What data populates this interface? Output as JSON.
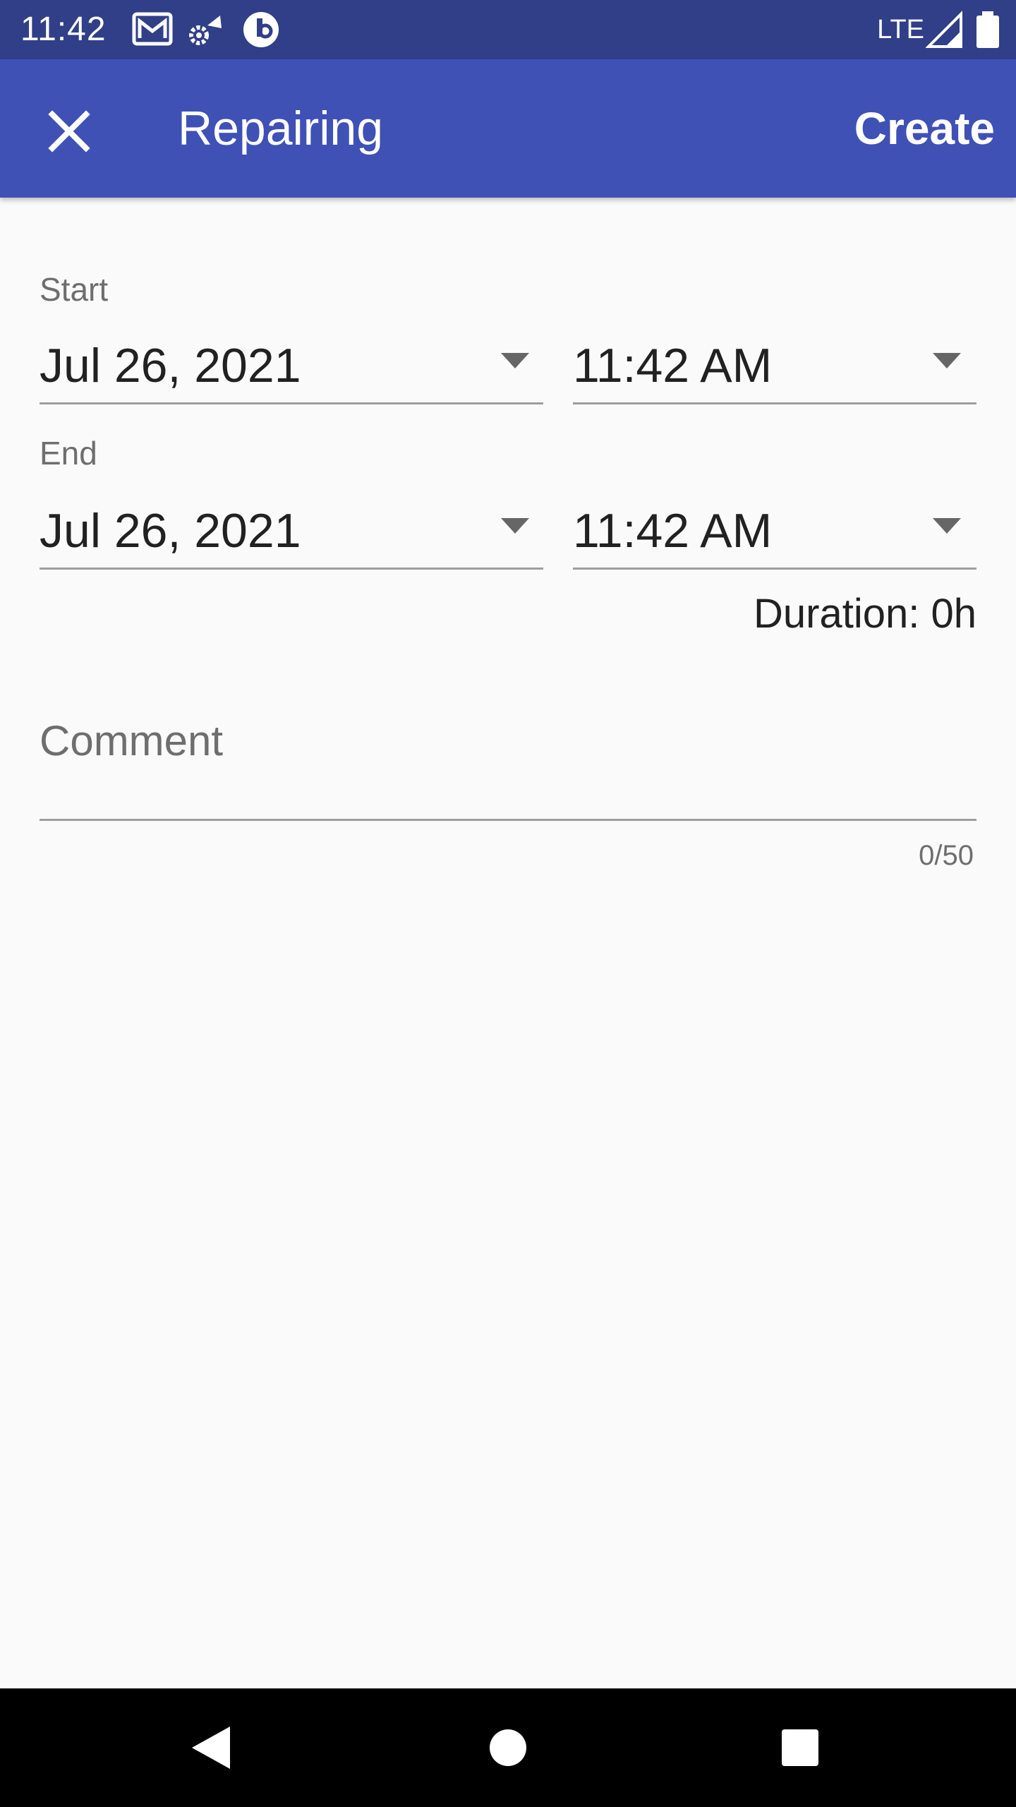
{
  "status_bar": {
    "time": "11:42",
    "network": "LTE",
    "icons": [
      "gmail-icon",
      "settings-sync-icon",
      "app-notification-icon",
      "signal-icon",
      "battery-icon"
    ]
  },
  "app_bar": {
    "title": "Repairing",
    "create_label": "Create",
    "background_color": "#3f51b5"
  },
  "form": {
    "start": {
      "label": "Start",
      "date": "Jul 26, 2021",
      "time": "11:42 AM"
    },
    "end": {
      "label": "End",
      "date": "Jul 26, 2021",
      "time": "11:42 AM"
    },
    "duration": "Duration: 0h",
    "comment": {
      "value": "",
      "placeholder": "Comment",
      "counter": "0/50"
    }
  },
  "nav_bar": {
    "icons": [
      "back-icon",
      "home-icon",
      "recents-icon"
    ]
  }
}
